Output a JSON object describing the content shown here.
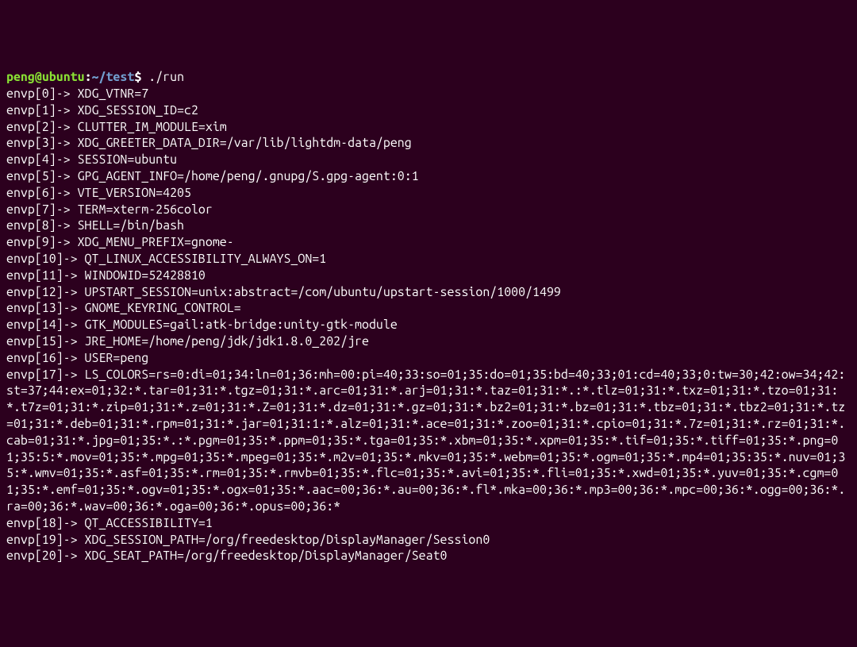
{
  "prompt": {
    "user": "peng",
    "at": "@",
    "host": "ubuntu",
    "colon": ":",
    "path": "~/test",
    "dollar": "$ ",
    "command": "./run"
  },
  "lines": [
    "envp[0]-> XDG_VTNR=7",
    "envp[1]-> XDG_SESSION_ID=c2",
    "envp[2]-> CLUTTER_IM_MODULE=xim",
    "envp[3]-> XDG_GREETER_DATA_DIR=/var/lib/lightdm-data/peng",
    "envp[4]-> SESSION=ubuntu",
    "envp[5]-> GPG_AGENT_INFO=/home/peng/.gnupg/S.gpg-agent:0:1",
    "envp[6]-> VTE_VERSION=4205",
    "envp[7]-> TERM=xterm-256color",
    "envp[8]-> SHELL=/bin/bash",
    "envp[9]-> XDG_MENU_PREFIX=gnome-",
    "envp[10]-> QT_LINUX_ACCESSIBILITY_ALWAYS_ON=1",
    "envp[11]-> WINDOWID=52428810",
    "envp[12]-> UPSTART_SESSION=unix:abstract=/com/ubuntu/upstart-session/1000/1499",
    "envp[13]-> GNOME_KEYRING_CONTROL=",
    "envp[14]-> GTK_MODULES=gail:atk-bridge:unity-gtk-module",
    "envp[15]-> JRE_HOME=/home/peng/jdk/jdk1.8.0_202/jre",
    "envp[16]-> USER=peng",
    "envp[17]-> LS_COLORS=rs=0:di=01;34:ln=01;36:mh=00:pi=40;33:so=01;35:do=01;35:bd=40;33;01:cd=40;33;0:tw=30;42:ow=34;42:st=37;44:ex=01;32:*.tar=01;31:*.tgz=01;31:*.arc=01;31:*.arj=01;31:*.taz=01;31:*.:*.tlz=01;31:*.txz=01;31:*.tzo=01;31:*.t7z=01;31:*.zip=01;31:*.z=01;31:*.Z=01;31:*.dz=01;31:*.gz=01;31:*.bz2=01;31:*.bz=01;31:*.tbz=01;31:*.tbz2=01;31:*.tz=01;31:*.deb=01;31:*.rpm=01;31:*.jar=01;31:1:*.alz=01;31:*.ace=01;31:*.zoo=01;31:*.cpio=01;31:*.7z=01;31:*.rz=01;31:*.cab=01;31:*.jpg=01;35:*.:*.pgm=01;35:*.ppm=01;35:*.tga=01;35:*.xbm=01;35:*.xpm=01;35:*.tif=01;35:*.tiff=01;35:*.png=01;35:5:*.mov=01;35:*.mpg=01;35:*.mpeg=01;35:*.m2v=01;35:*.mkv=01;35:*.webm=01;35:*.ogm=01;35:*.mp4=01;35:35:*.nuv=01;35:*.wmv=01;35:*.asf=01;35:*.rm=01;35:*.rmvb=01;35:*.flc=01;35:*.avi=01;35:*.fli=01;35:*.xwd=01;35:*.yuv=01;35:*.cgm=01;35:*.emf=01;35:*.ogv=01;35:*.ogx=01;35:*.aac=00;36:*.au=00;36:*.fl*.mka=00;36:*.mp3=00;36:*.mpc=00;36:*.ogg=00;36:*.ra=00;36:*.wav=00;36:*.oga=00;36:*.opus=00;36:*",
    "envp[18]-> QT_ACCESSIBILITY=1",
    "envp[19]-> XDG_SESSION_PATH=/org/freedesktop/DisplayManager/Session0",
    "envp[20]-> XDG_SEAT_PATH=/org/freedesktop/DisplayManager/Seat0"
  ]
}
